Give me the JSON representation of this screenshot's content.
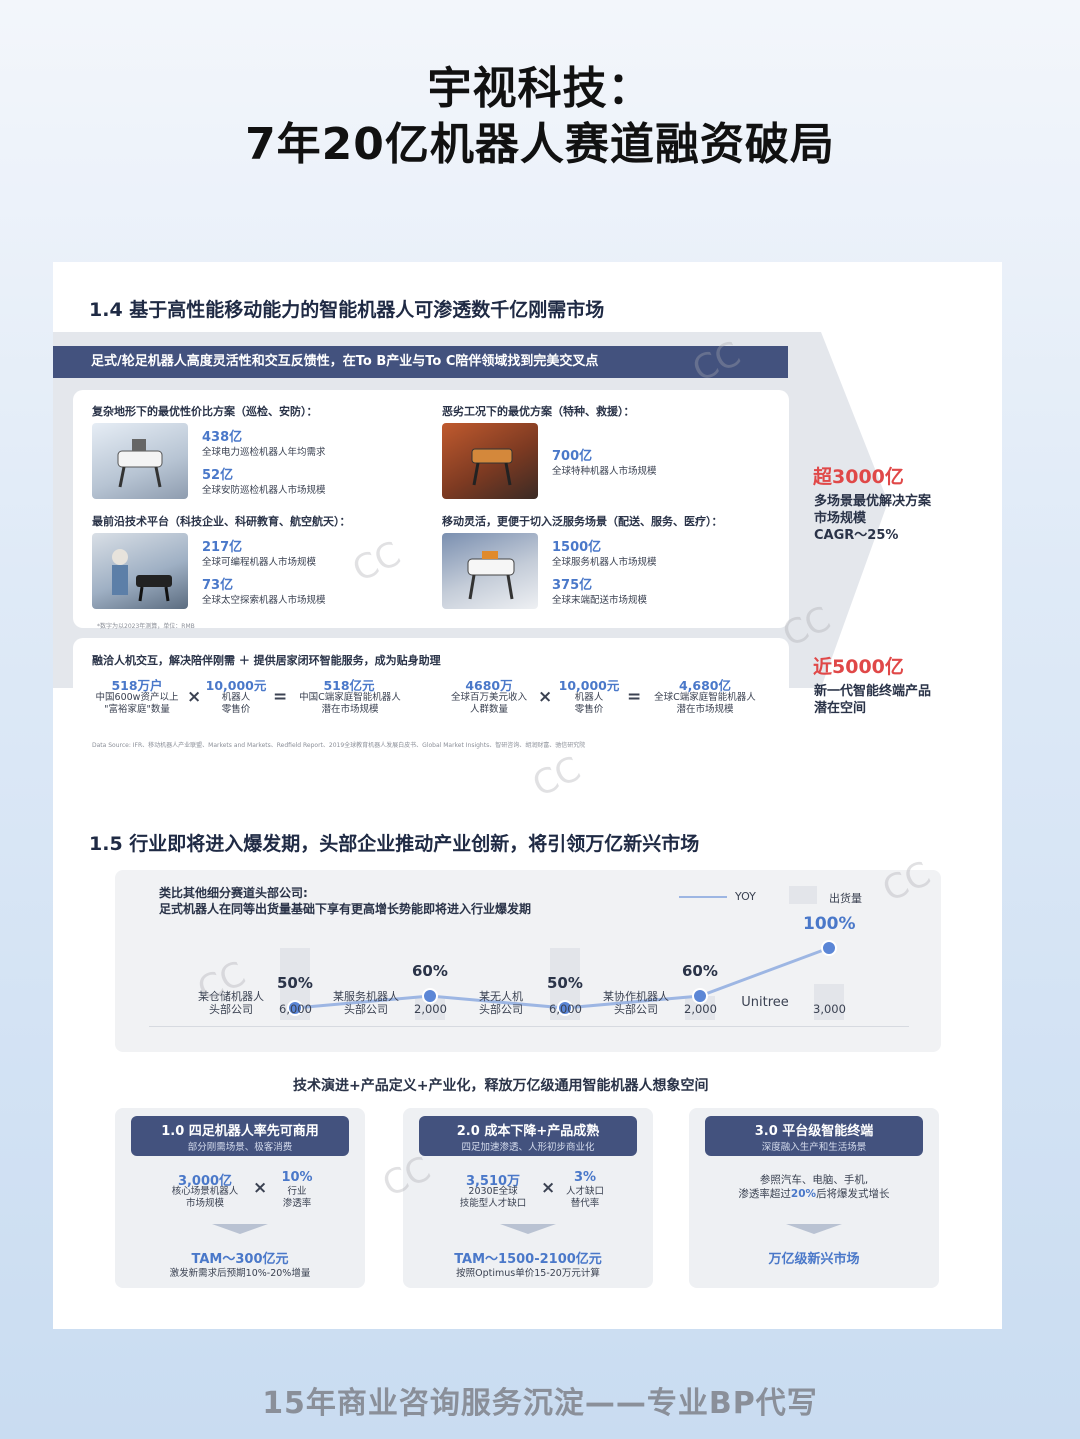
{
  "title": {
    "line1": "宇视科技：",
    "line2": "7年20亿机器人赛道融资破局"
  },
  "section14": {
    "heading": "1.4 基于高性能移动能力的智能机器人可渗透数千亿刚需市场",
    "banner": "足式/轮足机器人高度灵活性和交互反馈性，在To B产业与To C陪伴领域找到完美交叉点",
    "quadrants": [
      {
        "header": "复杂地形下的最优性价比方案（巡检、安防）：",
        "items": [
          {
            "value": "438亿",
            "label": "全球电力巡检机器人年均需求"
          },
          {
            "value": "52亿",
            "label": "全球安防巡检机器人市场规模"
          }
        ]
      },
      {
        "header": "恶劣工况下的最优方案（特种、救援）：",
        "items": [
          {
            "value": "700亿",
            "label": "全球特种机器人市场规模"
          }
        ]
      },
      {
        "header": "最前沿技术平台（科技企业、科研教育、航空航天）：",
        "items": [
          {
            "value": "217亿",
            "label": "全球可编程机器人市场规模"
          },
          {
            "value": "73亿",
            "label": "全球太空探索机器人市场规模"
          }
        ]
      },
      {
        "header": "移动灵活，更便于切入泛服务场景（配送、服务、医疗）：",
        "items": [
          {
            "value": "1500亿",
            "label": "全球服务机器人市场规模"
          },
          {
            "value": "375亿",
            "label": "全球末端配送市场规模"
          }
        ]
      }
    ],
    "note": "*数字为以2023年测算，单位：RMB",
    "side1": {
      "value": "超3000亿",
      "lines": [
        "多场景最优解决方案",
        "市场规模",
        "CAGR～25%"
      ]
    },
    "formula_header": "融洽人机交互，解决陪伴刚需 ＋ 提供居家闭环智能服务，成为贴身助理",
    "formula_left": [
      {
        "value": "518万户",
        "label": [
          "中国600w资产以上",
          "\"富裕家庭\"数量"
        ]
      },
      {
        "op": "×"
      },
      {
        "value": "10,000元",
        "label": [
          "机器人",
          "零售价"
        ]
      },
      {
        "op": "="
      },
      {
        "value": "518亿元",
        "label": [
          "中国C端家庭智能机器人",
          "潜在市场规模"
        ]
      }
    ],
    "formula_right": [
      {
        "value": "4680万",
        "label": [
          "全球百万美元收入",
          "人群数量"
        ]
      },
      {
        "op": "×"
      },
      {
        "value": "10,000元",
        "label": [
          "机器人",
          "零售价"
        ]
      },
      {
        "op": "="
      },
      {
        "value": "4,680亿",
        "label": [
          "全球C端家庭智能机器人",
          "潜在市场规模"
        ]
      }
    ],
    "side2": {
      "value": "近5000亿",
      "lines": [
        "新一代智能终端产品",
        "潜在空间"
      ]
    },
    "source": "Data Source: IFR、移动机器人产业联盟、Markets and Markets、Redfield Report、2019全球教育机器人发展白皮书、Global Market Insights、智研咨询、胡润财富、驰信研究院"
  },
  "section15": {
    "heading": "1.5 行业即将进入爆发期，头部企业推动产业创新，将引领万亿新兴市场",
    "chart_title": [
      "类比其他细分赛道头部公司:",
      "足式机器人在同等出货量基础下享有更高增长势能即将进入行业爆发期"
    ],
    "legend": {
      "line": "YOY",
      "bar": "出货量"
    }
  },
  "chart_data": {
    "type": "bar",
    "title": "类比其他细分赛道头部公司: 足式机器人在同等出货量基础下享有更高增长势能即将进入行业爆发期",
    "categories": [
      "某仓储机器人头部公司",
      "某服务机器人头部公司",
      "某无人机头部公司",
      "某协作机器人头部公司",
      "Unitree"
    ],
    "category_lines": [
      [
        "某仓储机器人",
        "头部公司"
      ],
      [
        "某服务机器人",
        "头部公司"
      ],
      [
        "某无人机",
        "头部公司"
      ],
      [
        "某协作机器人",
        "头部公司"
      ],
      [
        "Unitree"
      ]
    ],
    "series": [
      {
        "name": "出货量",
        "type": "bar",
        "values": [
          6000,
          2000,
          6000,
          2000,
          3000
        ],
        "labels": [
          "6,000",
          "2,000",
          "6,000",
          "2,000",
          "3,000"
        ]
      },
      {
        "name": "YOY",
        "type": "line",
        "values": [
          50,
          60,
          50,
          60,
          100
        ],
        "labels": [
          "50%",
          "60%",
          "50%",
          "60%",
          "100%"
        ]
      }
    ],
    "colors": {
      "bar": "#e3e5ea",
      "line": "#9db6e3",
      "point": "#5b86d6",
      "highlight": "#4a78c9"
    }
  },
  "summary": "技术演进+产品定义+产业化，释放万亿级通用智能机器人想象空间",
  "cards": [
    {
      "title": "1.0 四足机器人率先可商用",
      "subtitle": "部分刚需场景、极客消费",
      "v1": "3,000亿",
      "d1": [
        "核心场景机器人",
        "市场规模"
      ],
      "op": "×",
      "v2": "10%",
      "d2": [
        "行业",
        "渗透率"
      ],
      "tam": "TAM～300亿元",
      "tam_desc": "激发新需求后预期10%-20%增量"
    },
    {
      "title": "2.0 成本下降+产品成熟",
      "subtitle": "四足加速渗透、人形初步商业化",
      "v1": "3,510万",
      "d1": [
        "2030E全球",
        "技能型人才缺口"
      ],
      "op": "×",
      "v2": "3%",
      "d2": [
        "人才缺口",
        "替代率"
      ],
      "tam": "TAM～1500-2100亿元",
      "tam_desc": "按照Optimus单价15-20万元计算"
    },
    {
      "title": "3.0 平台级智能终端",
      "subtitle": "深度融入生产和生活场景",
      "text1": "参照汽车、电脑、手机,",
      "text2a": "渗透率超过",
      "text2b": "20%",
      "text2c": "后将爆发式增长",
      "tam": "万亿级新兴市场"
    }
  ],
  "footer": "15年商业咨询服务沉淀——专业BP代写",
  "colors": {
    "accent": "#4a78c9",
    "banner": "#43527e",
    "red": "#e04848"
  }
}
